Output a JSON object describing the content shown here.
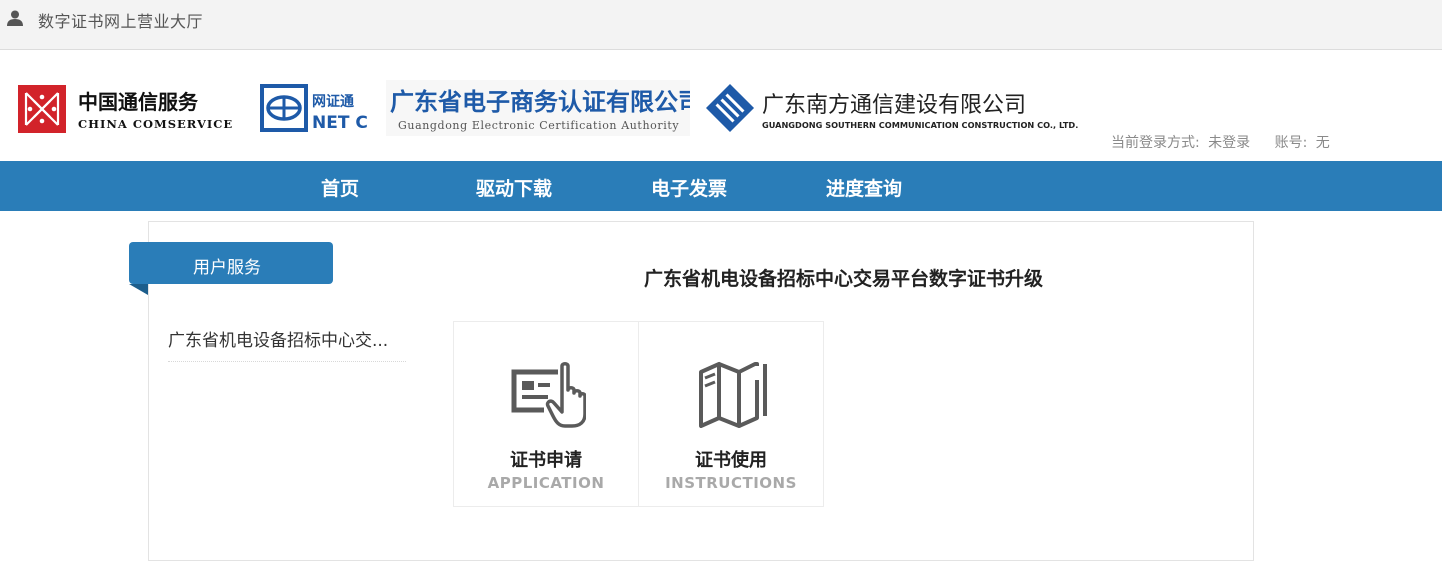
{
  "topbar": {
    "title": "数字证书网上营业大厅"
  },
  "logos": {
    "comservice": {
      "cn": "中国通信服务",
      "en": "CHINA COMSERVICE"
    },
    "netca": {
      "cn": "网证通",
      "en": "NET CA"
    },
    "gdca": {
      "cn": "广东省电子商务认证有限公司",
      "en": "Guangdong Electronic Certification Authority"
    },
    "southern": {
      "cn": "广东南方通信建设有限公司",
      "en": "GUANGDONG SOUTHERN COMMUNICATION CONSTRUCTION CO., LTD."
    }
  },
  "login": {
    "method_label": "当前登录方式:",
    "method_value": "未登录",
    "account_label": "账号:",
    "account_value": "无"
  },
  "nav": [
    {
      "label": "首页"
    },
    {
      "label": "驱动下载"
    },
    {
      "label": "电子发票"
    },
    {
      "label": "进度查询"
    }
  ],
  "sidebar": {
    "tab_label": "用户服务",
    "items": [
      {
        "label": "广东省机电设备招标中心交..."
      }
    ]
  },
  "content": {
    "title": "广东省机电设备招标中心交易平台数字证书升级",
    "cards": [
      {
        "label": "证书申请",
        "sub": "APPLICATION",
        "icon": "form-hand-icon"
      },
      {
        "label": "证书使用",
        "sub": "INSTRUCTIONS",
        "icon": "manual-book-icon"
      }
    ]
  },
  "colors": {
    "brand_blue": "#2a7db8",
    "brand_red": "#d2232a",
    "netca_blue": "#1e5aa8"
  }
}
